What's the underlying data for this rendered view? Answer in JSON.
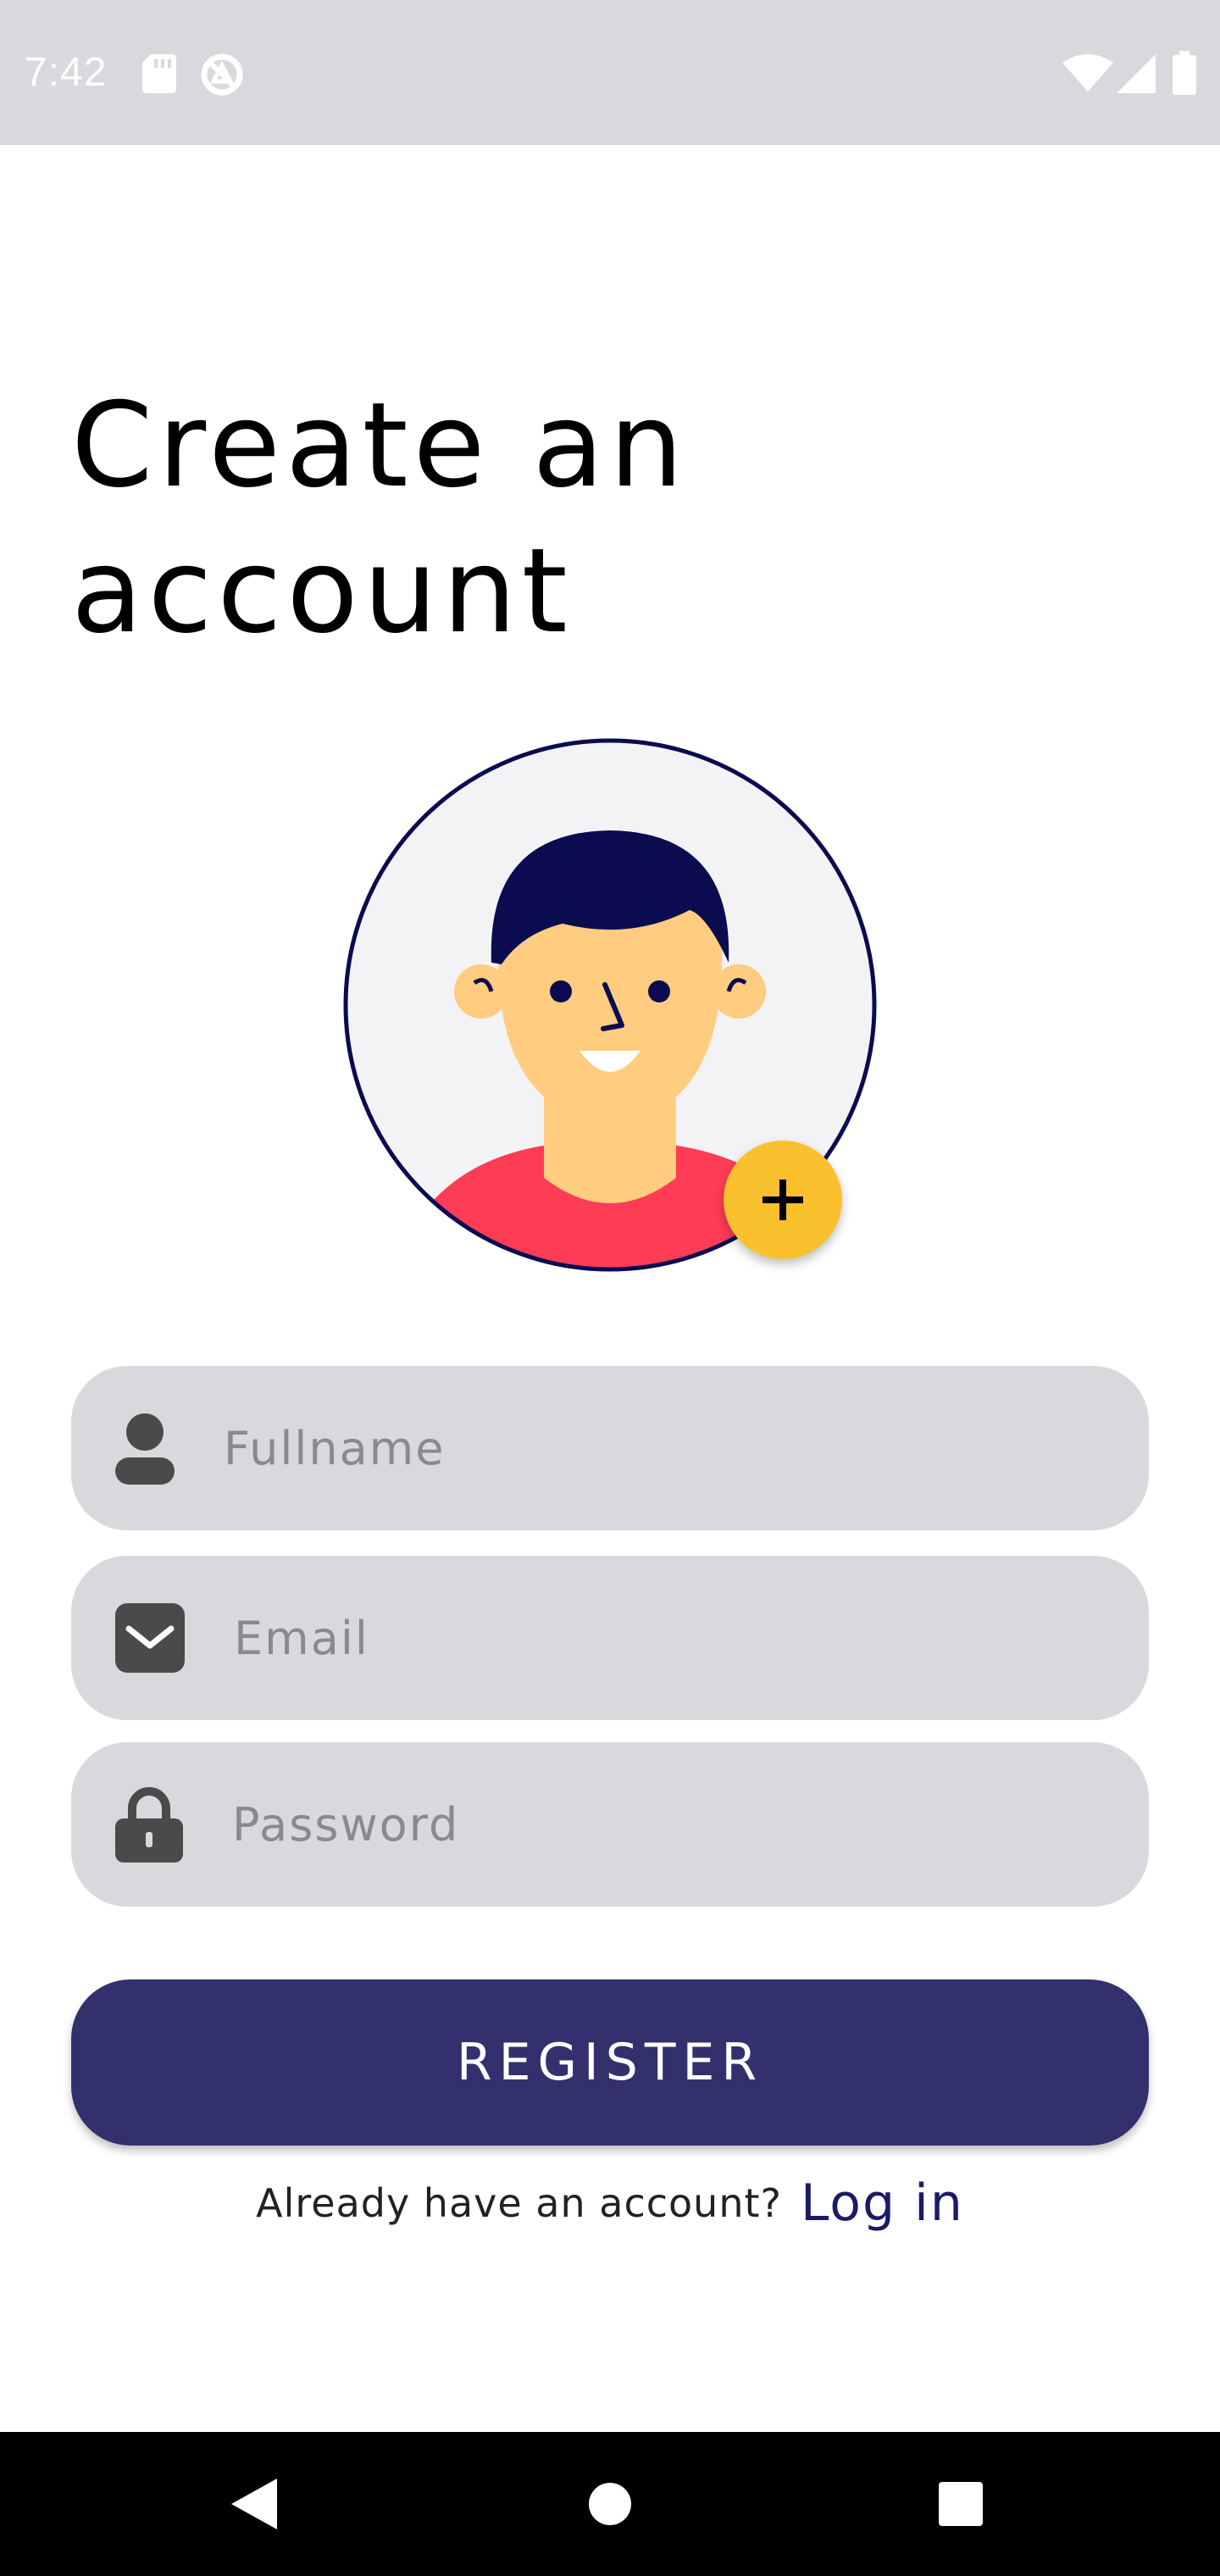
{
  "status_bar": {
    "time": "7:42",
    "icons": [
      "sd-card-icon",
      "do-not-disturb-icon",
      "wifi-icon",
      "signal-icon",
      "battery-icon"
    ]
  },
  "title": {
    "line1": "Create an",
    "line2": "account"
  },
  "avatar": {
    "add_button_icon": "plus-icon",
    "accent_color": "#fbc02d",
    "ring_color": "#0b0b4f"
  },
  "form": {
    "fullname": {
      "placeholder": "Fullname",
      "icon": "person-icon"
    },
    "email": {
      "placeholder": "Email",
      "icon": "mail-icon"
    },
    "password": {
      "placeholder": "Password",
      "icon": "lock-icon"
    }
  },
  "register_button": {
    "label": "REGISTER",
    "color": "#33306e"
  },
  "login": {
    "prompt": "Already have an account?",
    "link": "Log in"
  },
  "nav_bar": {
    "buttons": [
      "back-icon",
      "home-icon",
      "recents-icon"
    ]
  }
}
